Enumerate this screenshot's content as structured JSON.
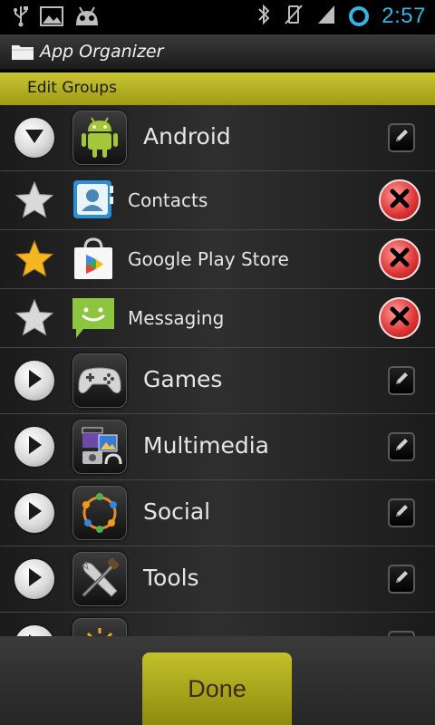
{
  "status_bar": {
    "time": "2:57",
    "icons": [
      "usb-icon",
      "image-icon",
      "android-debug-icon",
      "bluetooth-icon",
      "vibrate-icon",
      "signal-icon",
      "sync-ring-icon"
    ],
    "accent": "#33b5e5"
  },
  "app_bar": {
    "title": "App Organizer",
    "icon": "folder-icon"
  },
  "section": {
    "title": "Edit Groups"
  },
  "groups": [
    {
      "label": "Android",
      "icon": "android-icon",
      "expanded": true,
      "apps": [
        {
          "label": "Contacts",
          "icon": "contacts-icon",
          "starred": false
        },
        {
          "label": "Google Play Store",
          "icon": "play-store-icon",
          "starred": true
        },
        {
          "label": "Messaging",
          "icon": "messaging-icon",
          "starred": false
        }
      ]
    },
    {
      "label": "Games",
      "icon": "gamepad-icon",
      "expanded": false
    },
    {
      "label": "Multimedia",
      "icon": "multimedia-icon",
      "expanded": false
    },
    {
      "label": "Social",
      "icon": "social-icon",
      "expanded": false
    },
    {
      "label": "Tools",
      "icon": "tools-icon",
      "expanded": false
    },
    {
      "label": "",
      "icon": "sun-icon",
      "expanded": false
    }
  ],
  "done_button": {
    "label": "Done"
  },
  "colors": {
    "accent_yellow": "#b9b522",
    "remove_red": "#e23a3a"
  }
}
